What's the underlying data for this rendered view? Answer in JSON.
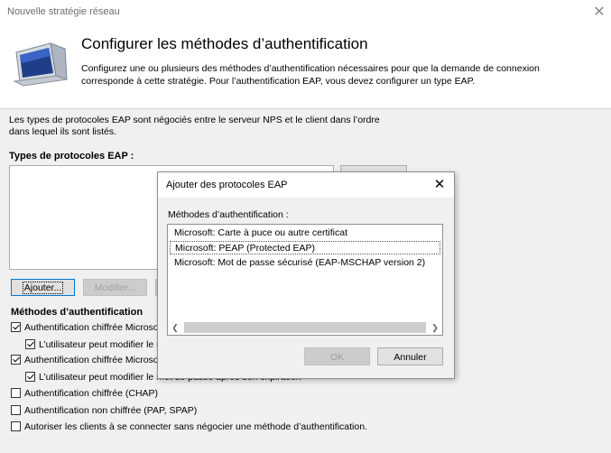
{
  "window": {
    "title": "Nouvelle stratégie réseau"
  },
  "header": {
    "title": "Configurer les méthodes d’authentification",
    "description_line1": "Configurez une ou plusieurs des méthodes d’authentification nécessaires pour que la demande de connexion",
    "description_line2": "corresponde à cette stratégie. Pour l’authentification EAP, vous devez configurer un type EAP."
  },
  "main": {
    "intro_line1": "Les types de protocoles EAP sont négociés entre le serveur NPS et le client dans l’ordre",
    "intro_line2": "dans lequel ils sont listés.",
    "eap_label": "Types de protocoles EAP :",
    "add_button": "Ajouter...",
    "modify_button": "Modifier...",
    "methods_label": "Méthodes d’authentification",
    "options": [
      {
        "label": "Authentification chiffrée Microsoft version 2 (MS-CHAP-v2)",
        "checked": true
      },
      {
        "label": "L’utilisateur peut modifier le mot de passe après son expiration",
        "checked": true
      },
      {
        "label": "Authentification chiffrée Microsoft (MS-CHAP)",
        "checked": true
      },
      {
        "label": "L’utilisateur peut modifier le mot de passe après son expiration",
        "checked": true
      },
      {
        "label": "Authentification chiffrée (CHAP)",
        "checked": false
      },
      {
        "label": "Authentification non chiffrée (PAP, SPAP)",
        "checked": false
      },
      {
        "label": "Autoriser les clients à se connecter sans négocier une méthode d’authentification.",
        "checked": false
      }
    ]
  },
  "dialog": {
    "title": "Ajouter des protocoles EAP",
    "list_label": "Méthodes d’authentification :",
    "items": [
      "Microsoft: Carte à puce ou autre certificat",
      "Microsoft: PEAP (Protected EAP)",
      "Microsoft: Mot de passe sécurisé (EAP-MSCHAP version 2)"
    ],
    "selected_index": 1,
    "ok_button": "OK",
    "cancel_button": "Annuler"
  },
  "icons": {
    "close": "close-icon",
    "network_policy": "network-computer-icon",
    "scroll_left": "scroll-left-icon",
    "scroll_right": "scroll-right-icon"
  }
}
